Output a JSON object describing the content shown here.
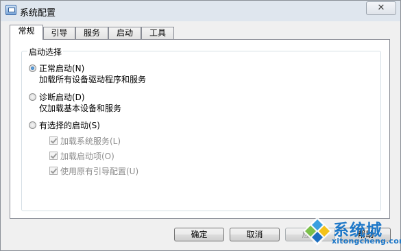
{
  "window": {
    "title": "系统配置",
    "close_glyph": "✕"
  },
  "tabs": [
    {
      "label": "常规",
      "active": true
    },
    {
      "label": "引导",
      "active": false
    },
    {
      "label": "服务",
      "active": false
    },
    {
      "label": "启动",
      "active": false
    },
    {
      "label": "工具",
      "active": false
    }
  ],
  "startup_group": {
    "legend": "启动选择",
    "normal": {
      "label": "正常启动(N)",
      "desc": "加载所有设备驱动程序和服务",
      "checked": true
    },
    "diagnostic": {
      "label": "诊断启动(D)",
      "desc": "仅加载基本设备和服务",
      "checked": false
    },
    "selective": {
      "label": "有选择的启动(S)",
      "checked": false,
      "options": [
        {
          "label": "加载系统服务(L)",
          "checked": true
        },
        {
          "label": "加载启动项(O)",
          "checked": true
        },
        {
          "label": "使用原有引导配置(U)",
          "checked": true
        }
      ]
    }
  },
  "buttons": {
    "ok": "确定",
    "cancel": "取消",
    "apply": "应用",
    "help": "帮助"
  },
  "watermark": {
    "brand": "系统城",
    "url": "xitongcheng.com"
  },
  "colors": {
    "accent": "#1e78c8",
    "titlebar": "#dfe6ee",
    "panel": "#ffffff"
  }
}
